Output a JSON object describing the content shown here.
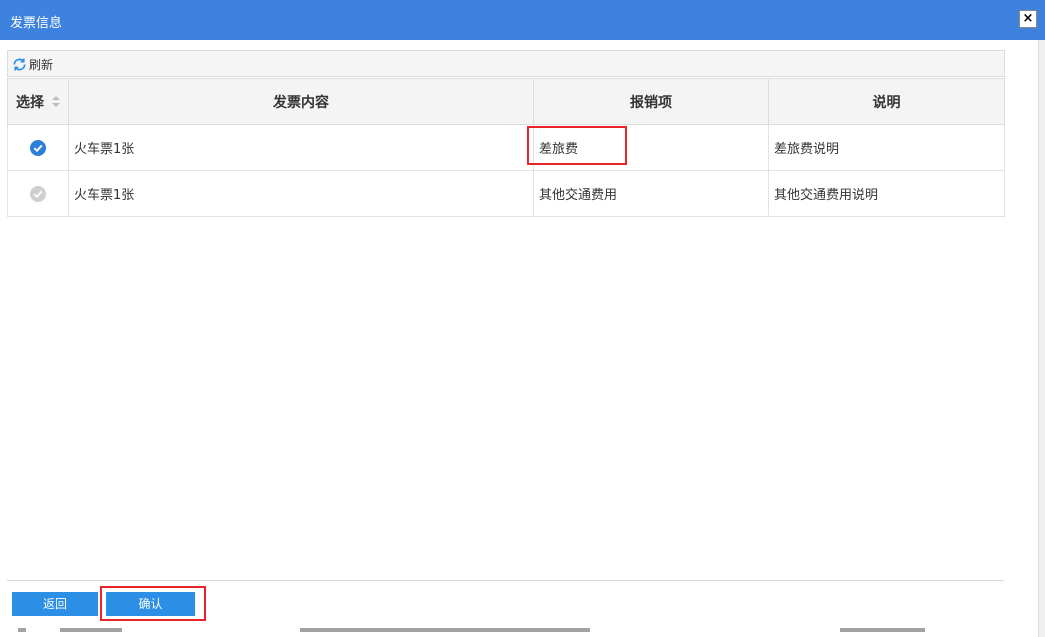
{
  "dialog": {
    "title": "发票信息",
    "close_symbol": "×"
  },
  "toolbar": {
    "refresh_label": "刷新"
  },
  "table": {
    "headers": {
      "select": "选择",
      "content": "发票内容",
      "item": "报销项",
      "note": "说明"
    },
    "rows": [
      {
        "selected": true,
        "content": "火车票1张",
        "item": "差旅费",
        "note": "差旅费说明"
      },
      {
        "selected": false,
        "content": "火车票1张",
        "item": "其他交通费用",
        "note": "其他交通费用说明"
      }
    ]
  },
  "footer": {
    "back_label": "返回",
    "confirm_label": "确认"
  },
  "colors": {
    "titlebar": "#3d82de",
    "button": "#2b8fe6",
    "highlight": "#e8232a",
    "check_active": "#2b7fd8",
    "check_inactive": "#cfcfcf"
  },
  "icons": {
    "refresh": "refresh-icon",
    "sort": "sort-icon",
    "check": "check-circle-icon",
    "close": "close-icon"
  }
}
